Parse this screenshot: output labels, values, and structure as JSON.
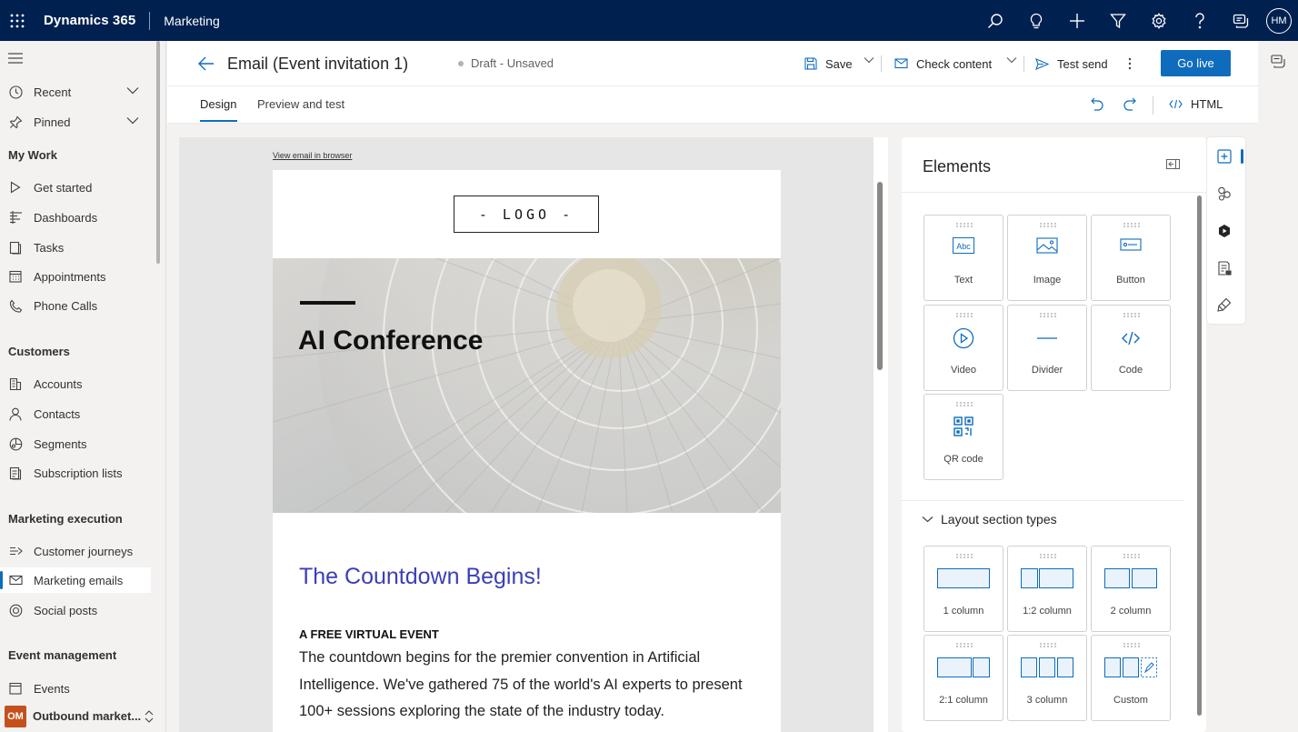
{
  "topbar": {
    "brand": "Dynamics 365",
    "app": "Marketing",
    "user_initials": "HM",
    "icons": [
      "search-icon",
      "lightbulb-icon",
      "plus-icon",
      "filter-icon",
      "settings-icon",
      "help-icon",
      "chat-icon"
    ]
  },
  "sidebar": {
    "recent": "Recent",
    "pinned": "Pinned",
    "groups": [
      "My Work",
      "Customers",
      "Marketing execution",
      "Event management"
    ],
    "mywork": [
      "Get started",
      "Dashboards",
      "Tasks",
      "Appointments",
      "Phone Calls"
    ],
    "customers": [
      "Accounts",
      "Contacts",
      "Segments",
      "Subscription lists"
    ],
    "execution": [
      "Customer journeys",
      "Marketing emails",
      "Social posts"
    ],
    "events": [
      "Events"
    ],
    "area": {
      "badge": "OM",
      "label": "Outbound market..."
    }
  },
  "header": {
    "title": "Email (Event invitation 1)",
    "status": "Draft - Unsaved",
    "save": "Save",
    "check_content": "Check content",
    "test_send": "Test send",
    "go_live": "Go live"
  },
  "tabs": {
    "design": "Design",
    "preview": "Preview and test",
    "html": "HTML"
  },
  "email": {
    "view_in_browser": "View email in browser",
    "logo": "- LOGO -",
    "hero_title": "AI Conference",
    "heading": "The Countdown Begins!",
    "kicker": "A FREE VIRTUAL EVENT",
    "body": "The countdown begins for the premier convention in Artificial Intelligence. We've gathered 75 of the world's AI experts to present 100+ sessions exploring the state of the industry today."
  },
  "panel": {
    "title": "Elements",
    "elements": [
      "Text",
      "Image",
      "Button",
      "Video",
      "Divider",
      "Code",
      "QR code"
    ],
    "layout_title": "Layout section types",
    "layouts": [
      "1 column",
      "1:2 column",
      "2 column",
      "2:1 column",
      "3 column",
      "Custom"
    ]
  },
  "colors": {
    "topbar": "#002050",
    "accent": "#0f6cbd",
    "heading": "#3b3fb5",
    "badge": "#c5501b"
  }
}
